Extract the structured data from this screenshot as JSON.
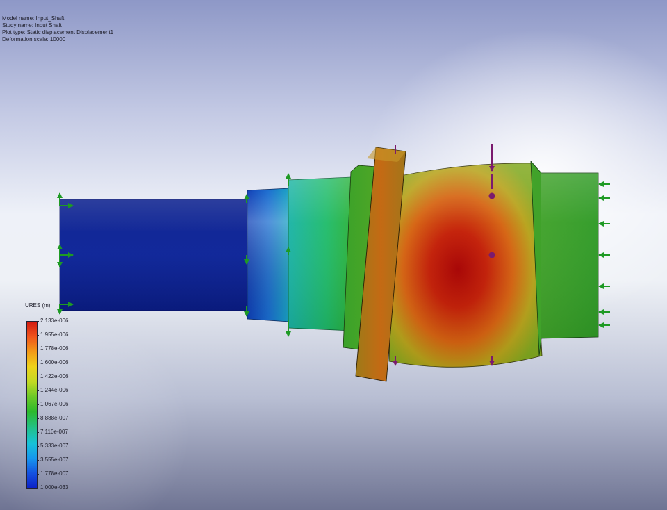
{
  "info": {
    "model_name": "Model name: Input_Shaft",
    "study_name": "Study name: Input Shaft",
    "plot_type": "Plot type: Static displacement Displacement1",
    "deformation_scale": "Deformation scale: 10000"
  },
  "legend": {
    "title": "URES (m)",
    "labels": [
      "2.133e-006",
      "1.955e-006",
      "1.778e-006",
      "1.600e-006",
      "1.422e-006",
      "1.244e-006",
      "1.067e-006",
      "8.888e-007",
      "7.110e-007",
      "5.333e-007",
      "3.555e-007",
      "1.778e-007",
      "1.000e-033"
    ],
    "max_color": "#d21a10",
    "min_color": "#0d20c6"
  },
  "colors": {
    "low": "#0d1f8c",
    "mid": "#1fbf7a",
    "high": "#b80000",
    "fixture_arrow": "#1e9a24",
    "load_arrow": "#7a1a6e"
  }
}
